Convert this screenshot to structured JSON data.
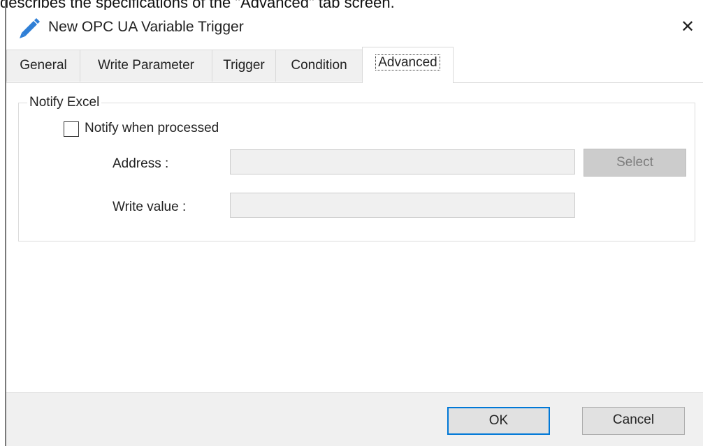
{
  "doc_caption": "describes the specifications of the \"Advanced\" tab screen.",
  "dialog": {
    "title": "New OPC UA Variable Trigger",
    "icon": "pencil-icon",
    "close_glyph": "✕",
    "accent_color": "#0078d7"
  },
  "tabs": [
    {
      "label": "General",
      "active": false
    },
    {
      "label": "Write Parameter",
      "active": false
    },
    {
      "label": "Trigger",
      "active": false
    },
    {
      "label": "Condition",
      "active": false
    },
    {
      "label": "Advanced",
      "active": true
    }
  ],
  "notify_excel": {
    "group_label": "Notify Excel",
    "checkbox_label": "Notify when processed",
    "checked": false,
    "address_label": "Address :",
    "address_value": "",
    "select_label": "Select",
    "write_value_label": "Write value :",
    "write_value": ""
  },
  "footer": {
    "ok_label": "OK",
    "cancel_label": "Cancel"
  }
}
